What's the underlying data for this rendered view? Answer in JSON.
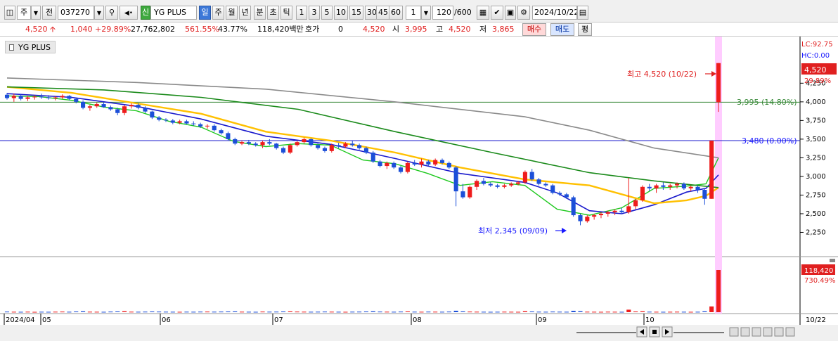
{
  "toolbar": {
    "market_mode": "주",
    "prev_label": "전",
    "stock_code": "037270",
    "stock_name_badge": "신",
    "stock_name": "YG PLUS",
    "periods": [
      "일",
      "주",
      "월",
      "년",
      "분",
      "초",
      "틱"
    ],
    "selected_period": "일",
    "intervals": [
      "1",
      "3",
      "5",
      "10",
      "15",
      "30",
      "45",
      "60"
    ],
    "interval_select": "1",
    "count_value": "120",
    "count_max": "/600",
    "date_value": "2024/10/22"
  },
  "quote": {
    "price": "4,520",
    "change": "1,040",
    "change_pct": "+29.89%",
    "volume": "27,762,802",
    "volume_pct": "561.55%",
    "turnover_pct": "43.77%",
    "amount": "118,420백만",
    "hoga_label": "호가",
    "hoga_value": "0",
    "ask_price": "4,520",
    "open_label": "시",
    "open_value": "3,995",
    "high_label": "고",
    "high_value": "4,520",
    "low_label": "저",
    "low_value": "3,865",
    "buy_label": "매수",
    "sell_label": "매도",
    "flat_label": "평"
  },
  "legend": {
    "label": "YG PLUS"
  },
  "price_panel": {
    "lc_label": "LC:92.75",
    "hc_label": "HC:0.00",
    "last_price": "4,520",
    "last_pct": "29.89%",
    "high_annotation": "최고 4,520 (10/22)",
    "low_annotation": "최저 2,345 (09/09)",
    "line1_label": "3,995 (14.80%)",
    "line2_label": "3,480 (0.00%)",
    "colors": {
      "up": "#ee1c1c",
      "down": "#1c4fd8",
      "ma5": "#1ec81e",
      "ma20": "#1a1acc",
      "ma60": "#ffc000",
      "ma120": "#1a8a1a",
      "ma240": "#8a8a8a",
      "highlight": "#ffccff"
    }
  },
  "volume_panel": {
    "last_volume": "118,420",
    "last_pct": "730.49%"
  },
  "chart_data": {
    "type": "candlestick",
    "y_ticks": [
      "4,250",
      "4,000",
      "3,750",
      "3,500",
      "3,250",
      "3,000",
      "2,750",
      "2,500",
      "2,250"
    ],
    "ylim": [
      2000,
      4800
    ],
    "x_labels": [
      "2024/04",
      "05",
      "06",
      "07",
      "08",
      "09",
      "10"
    ],
    "x_end_label": "10/22",
    "series": [
      {
        "name": "candles",
        "ohlc": [
          [
            4095,
            4120,
            4030,
            4050
          ],
          [
            4050,
            4110,
            4000,
            4080
          ],
          [
            4080,
            4100,
            4020,
            4040
          ],
          [
            4040,
            4080,
            4010,
            4060
          ],
          [
            4060,
            4090,
            4030,
            4070
          ],
          [
            4070,
            4110,
            4040,
            4060
          ],
          [
            4060,
            4090,
            4030,
            4050
          ],
          [
            4050,
            4080,
            4020,
            4060
          ],
          [
            4060,
            4100,
            4040,
            4080
          ],
          [
            4080,
            4090,
            4020,
            4040
          ],
          [
            4040,
            4060,
            3980,
            4000
          ],
          [
            4000,
            4020,
            3900,
            3920
          ],
          [
            3920,
            3960,
            3880,
            3940
          ],
          [
            3940,
            3990,
            3920,
            3970
          ],
          [
            3970,
            3990,
            3920,
            3930
          ],
          [
            3930,
            3950,
            3880,
            3900
          ],
          [
            3900,
            3920,
            3820,
            3850
          ],
          [
            3850,
            3960,
            3820,
            3940
          ],
          [
            3940,
            3980,
            3910,
            3960
          ],
          [
            3960,
            3980,
            3900,
            3920
          ],
          [
            3920,
            3940,
            3850,
            3870
          ],
          [
            3870,
            3880,
            3770,
            3790
          ],
          [
            3790,
            3810,
            3740,
            3760
          ],
          [
            3760,
            3780,
            3730,
            3750
          ],
          [
            3750,
            3770,
            3700,
            3720
          ],
          [
            3720,
            3760,
            3700,
            3740
          ],
          [
            3740,
            3760,
            3700,
            3710
          ],
          [
            3710,
            3740,
            3680,
            3700
          ],
          [
            3700,
            3720,
            3650,
            3670
          ],
          [
            3670,
            3700,
            3640,
            3680
          ],
          [
            3680,
            3700,
            3600,
            3620
          ],
          [
            3620,
            3640,
            3560,
            3580
          ],
          [
            3580,
            3600,
            3480,
            3500
          ],
          [
            3500,
            3520,
            3420,
            3440
          ],
          [
            3440,
            3480,
            3420,
            3460
          ],
          [
            3460,
            3490,
            3420,
            3440
          ],
          [
            3440,
            3460,
            3400,
            3420
          ],
          [
            3420,
            3480,
            3380,
            3460
          ],
          [
            3460,
            3500,
            3420,
            3440
          ],
          [
            3440,
            3450,
            3360,
            3380
          ],
          [
            3380,
            3400,
            3300,
            3320
          ],
          [
            3320,
            3440,
            3300,
            3420
          ],
          [
            3420,
            3480,
            3400,
            3460
          ],
          [
            3460,
            3520,
            3440,
            3500
          ],
          [
            3500,
            3510,
            3400,
            3420
          ],
          [
            3420,
            3440,
            3360,
            3380
          ],
          [
            3380,
            3400,
            3320,
            3340
          ],
          [
            3340,
            3440,
            3320,
            3420
          ],
          [
            3420,
            3450,
            3380,
            3400
          ],
          [
            3400,
            3460,
            3380,
            3440
          ],
          [
            3440,
            3480,
            3400,
            3420
          ],
          [
            3420,
            3440,
            3360,
            3380
          ],
          [
            3380,
            3400,
            3300,
            3320
          ],
          [
            3320,
            3340,
            3180,
            3200
          ],
          [
            3200,
            3220,
            3120,
            3140
          ],
          [
            3140,
            3200,
            3100,
            3180
          ],
          [
            3180,
            3200,
            3100,
            3120
          ],
          [
            3120,
            3140,
            3040,
            3060
          ],
          [
            3060,
            3200,
            3040,
            3180
          ],
          [
            3180,
            3220,
            3140,
            3160
          ],
          [
            3160,
            3240,
            3120,
            3200
          ],
          [
            3200,
            3220,
            3140,
            3160
          ],
          [
            3160,
            3240,
            3140,
            3220
          ],
          [
            3220,
            3240,
            3160,
            3180
          ],
          [
            3180,
            3200,
            3100,
            3120
          ],
          [
            3120,
            3140,
            2600,
            2800
          ],
          [
            2800,
            2900,
            2700,
            2720
          ],
          [
            2720,
            2880,
            2700,
            2860
          ],
          [
            2860,
            2960,
            2820,
            2940
          ],
          [
            2940,
            2980,
            2880,
            2900
          ],
          [
            2900,
            2920,
            2860,
            2880
          ],
          [
            2880,
            2900,
            2840,
            2860
          ],
          [
            2860,
            2900,
            2840,
            2880
          ],
          [
            2880,
            2920,
            2860,
            2900
          ],
          [
            2900,
            2940,
            2880,
            2920
          ],
          [
            2920,
            3080,
            2900,
            3060
          ],
          [
            3060,
            3100,
            2940,
            2960
          ],
          [
            2960,
            2980,
            2880,
            2900
          ],
          [
            2900,
            2920,
            2860,
            2880
          ],
          [
            2880,
            2900,
            2760,
            2780
          ],
          [
            2780,
            2800,
            2740,
            2760
          ],
          [
            2760,
            2780,
            2700,
            2720
          ],
          [
            2720,
            2740,
            2460,
            2480
          ],
          [
            2480,
            2500,
            2345,
            2400
          ],
          [
            2400,
            2480,
            2380,
            2460
          ],
          [
            2460,
            2500,
            2420,
            2480
          ],
          [
            2480,
            2520,
            2440,
            2500
          ],
          [
            2500,
            2540,
            2460,
            2520
          ],
          [
            2520,
            2560,
            2480,
            2540
          ],
          [
            2540,
            2580,
            2500,
            2520
          ],
          [
            2520,
            2980,
            2500,
            2600
          ],
          [
            2600,
            2700,
            2560,
            2680
          ],
          [
            2680,
            2880,
            2660,
            2860
          ],
          [
            2860,
            2900,
            2800,
            2840
          ],
          [
            2840,
            2900,
            2780,
            2880
          ],
          [
            2880,
            2920,
            2820,
            2860
          ],
          [
            2860,
            2900,
            2820,
            2880
          ],
          [
            2880,
            2920,
            2840,
            2900
          ],
          [
            2900,
            2920,
            2820,
            2840
          ],
          [
            2840,
            2880,
            2800,
            2860
          ],
          [
            2860,
            2880,
            2780,
            2820
          ],
          [
            2820,
            2840,
            2620,
            2700
          ],
          [
            2700,
            3480,
            2700,
            3480
          ],
          [
            3995,
            4520,
            3865,
            4520
          ]
        ]
      },
      {
        "name": "ma5",
        "values": [
          [
            0,
            4080
          ],
          [
            5,
            4070
          ],
          [
            10,
            4020
          ],
          [
            15,
            3930
          ],
          [
            20,
            3880
          ],
          [
            25,
            3740
          ],
          [
            30,
            3660
          ],
          [
            35,
            3470
          ],
          [
            40,
            3400
          ],
          [
            45,
            3440
          ],
          [
            50,
            3420
          ],
          [
            55,
            3220
          ],
          [
            60,
            3170
          ],
          [
            65,
            3040
          ],
          [
            70,
            2880
          ],
          [
            75,
            2930
          ],
          [
            80,
            2880
          ],
          [
            85,
            2560
          ],
          [
            90,
            2480
          ],
          [
            95,
            2580
          ],
          [
            100,
            2840
          ],
          [
            105,
            2870
          ],
          [
            108,
            2900
          ],
          [
            110,
            3250
          ]
        ]
      },
      {
        "name": "ma20",
        "values": [
          [
            0,
            4110
          ],
          [
            10,
            4060
          ],
          [
            20,
            3940
          ],
          [
            30,
            3770
          ],
          [
            40,
            3540
          ],
          [
            50,
            3430
          ],
          [
            60,
            3240
          ],
          [
            70,
            3040
          ],
          [
            80,
            2920
          ],
          [
            85,
            2780
          ],
          [
            90,
            2540
          ],
          [
            95,
            2500
          ],
          [
            100,
            2620
          ],
          [
            105,
            2790
          ],
          [
            108,
            2840
          ],
          [
            110,
            3020
          ]
        ]
      },
      {
        "name": "ma60",
        "values": [
          [
            0,
            4200
          ],
          [
            10,
            4120
          ],
          [
            20,
            3980
          ],
          [
            30,
            3840
          ],
          [
            40,
            3600
          ],
          [
            50,
            3480
          ],
          [
            60,
            3320
          ],
          [
            70,
            3120
          ],
          [
            80,
            2960
          ],
          [
            90,
            2880
          ],
          [
            100,
            2640
          ],
          [
            105,
            2680
          ],
          [
            108,
            2740
          ],
          [
            110,
            2850
          ]
        ]
      },
      {
        "name": "ma120",
        "values": [
          [
            0,
            4200
          ],
          [
            15,
            4160
          ],
          [
            30,
            4060
          ],
          [
            45,
            3900
          ],
          [
            60,
            3600
          ],
          [
            75,
            3320
          ],
          [
            90,
            3050
          ],
          [
            100,
            2940
          ],
          [
            110,
            2850
          ]
        ]
      },
      {
        "name": "ma240",
        "values": [
          [
            0,
            4320
          ],
          [
            20,
            4260
          ],
          [
            40,
            4170
          ],
          [
            60,
            4000
          ],
          [
            80,
            3800
          ],
          [
            90,
            3620
          ],
          [
            100,
            3380
          ],
          [
            110,
            3250
          ]
        ]
      },
      {
        "name": "volume",
        "values": [
          12,
          9,
          8,
          10,
          7,
          9,
          8,
          10,
          12,
          9,
          14,
          18,
          10,
          9,
          8,
          12,
          15,
          20,
          10,
          9,
          11,
          14,
          12,
          10,
          9,
          8,
          10,
          9,
          11,
          12,
          10,
          12,
          14,
          16,
          10,
          9,
          8,
          12,
          10,
          11,
          14,
          16,
          12,
          10,
          9,
          10,
          12,
          10,
          9,
          8,
          10,
          11,
          14,
          18,
          12,
          10,
          9,
          12,
          15,
          10,
          9,
          11,
          10,
          9,
          12,
          30,
          16,
          12,
          10,
          9,
          8,
          9,
          10,
          9,
          8,
          20,
          14,
          10,
          9,
          12,
          10,
          9,
          28,
          20,
          10,
          9,
          8,
          10,
          9,
          8,
          52,
          14,
          18,
          10,
          9,
          8,
          9,
          10,
          9,
          8,
          9,
          18,
          120,
          880
        ]
      }
    ]
  }
}
